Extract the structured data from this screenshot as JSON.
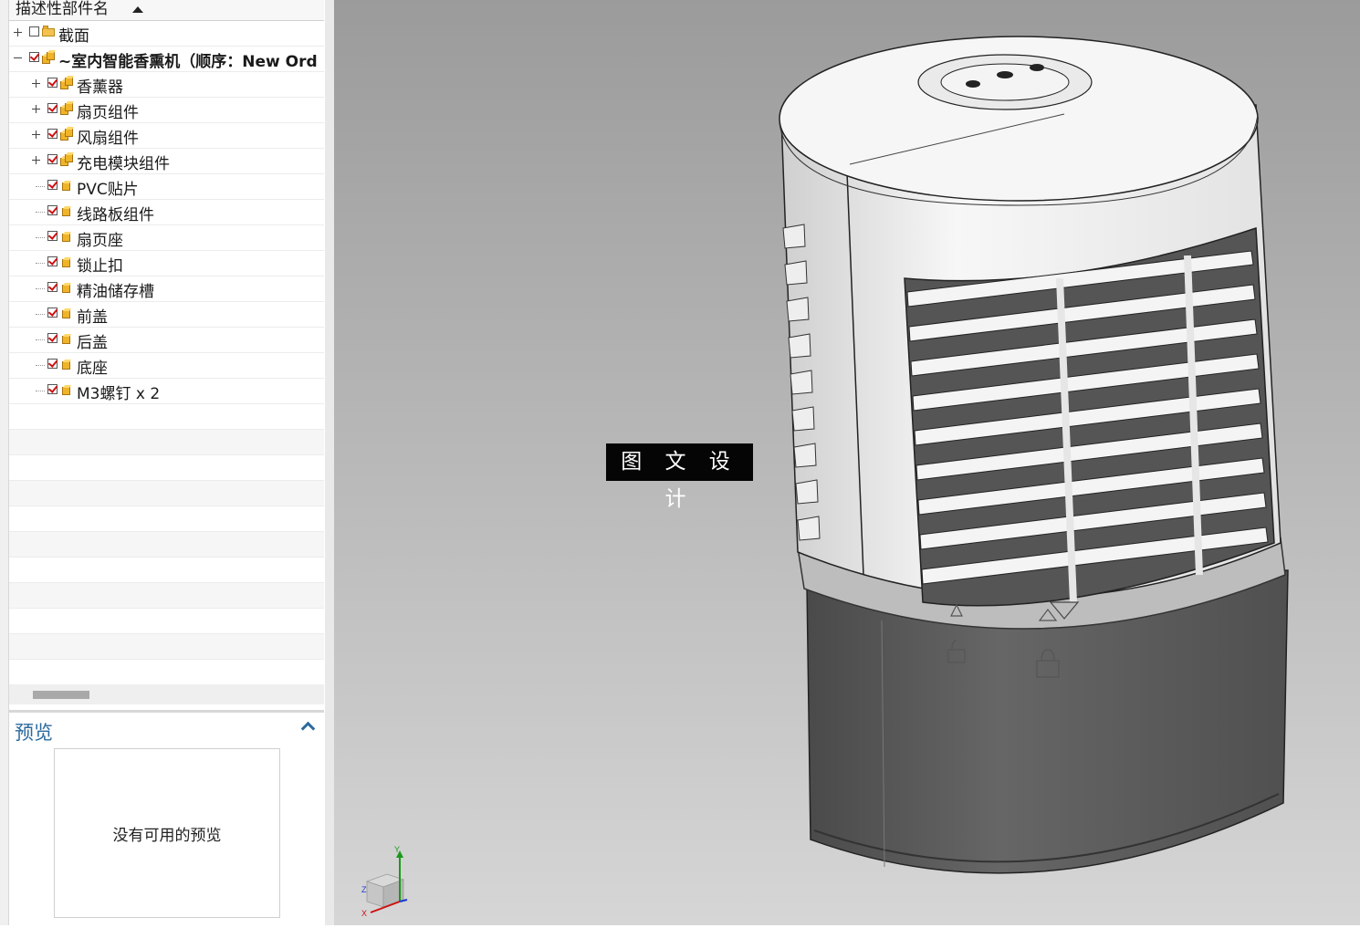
{
  "navigator": {
    "column_header": "描述性部件名",
    "rows": [
      {
        "label": "截面",
        "expander": "plus",
        "checked": false,
        "icon": "folder-icon",
        "bold": false,
        "indent": 0
      },
      {
        "label": "~室内智能香熏机（顺序：New Ord",
        "expander": "minus",
        "checked": true,
        "icon": "assembly-icon",
        "bold": true,
        "indent": 0
      },
      {
        "label": "香薰器",
        "expander": "plus",
        "checked": true,
        "icon": "assembly-icon",
        "bold": false,
        "indent": 1
      },
      {
        "label": "扇页组件",
        "expander": "plus",
        "checked": true,
        "icon": "assembly-icon",
        "bold": false,
        "indent": 1
      },
      {
        "label": "风扇组件",
        "expander": "plus",
        "checked": true,
        "icon": "assembly-icon",
        "bold": false,
        "indent": 1
      },
      {
        "label": "充电模块组件",
        "expander": "plus",
        "checked": true,
        "icon": "assembly-icon",
        "bold": false,
        "indent": 1
      },
      {
        "label": "PVC贴片",
        "expander": "none",
        "checked": true,
        "icon": "part-icon",
        "bold": false,
        "indent": 1
      },
      {
        "label": "线路板组件",
        "expander": "none",
        "checked": true,
        "icon": "part-icon",
        "bold": false,
        "indent": 1
      },
      {
        "label": "扇页座",
        "expander": "none",
        "checked": true,
        "icon": "part-icon",
        "bold": false,
        "indent": 1
      },
      {
        "label": "锁止扣",
        "expander": "none",
        "checked": true,
        "icon": "part-icon",
        "bold": false,
        "indent": 1
      },
      {
        "label": "精油储存槽",
        "expander": "none",
        "checked": true,
        "icon": "part-icon",
        "bold": false,
        "indent": 1
      },
      {
        "label": "前盖",
        "expander": "none",
        "checked": true,
        "icon": "part-icon",
        "bold": false,
        "indent": 1
      },
      {
        "label": "后盖",
        "expander": "none",
        "checked": true,
        "icon": "part-icon",
        "bold": false,
        "indent": 1
      },
      {
        "label": "底座",
        "expander": "none",
        "checked": true,
        "icon": "part-icon",
        "bold": false,
        "indent": 1
      },
      {
        "label": "M3螺钉 x 2",
        "expander": "none",
        "checked": true,
        "icon": "part-icon",
        "bold": false,
        "indent": 1
      }
    ]
  },
  "preview": {
    "title": "预览",
    "message": "没有可用的预览"
  },
  "viewport": {
    "watermark": "图 文 设 计",
    "triad_labels": {
      "y": "Y",
      "x": "X",
      "z": "Z"
    }
  },
  "colors": {
    "accent_blue": "#2c6a9e",
    "check_red": "#d01010",
    "viewport_top": "#9b9b9b",
    "viewport_bottom": "#d6d6d6",
    "model_body_white": "#f2f2f2",
    "model_base_dark": "#555555"
  }
}
